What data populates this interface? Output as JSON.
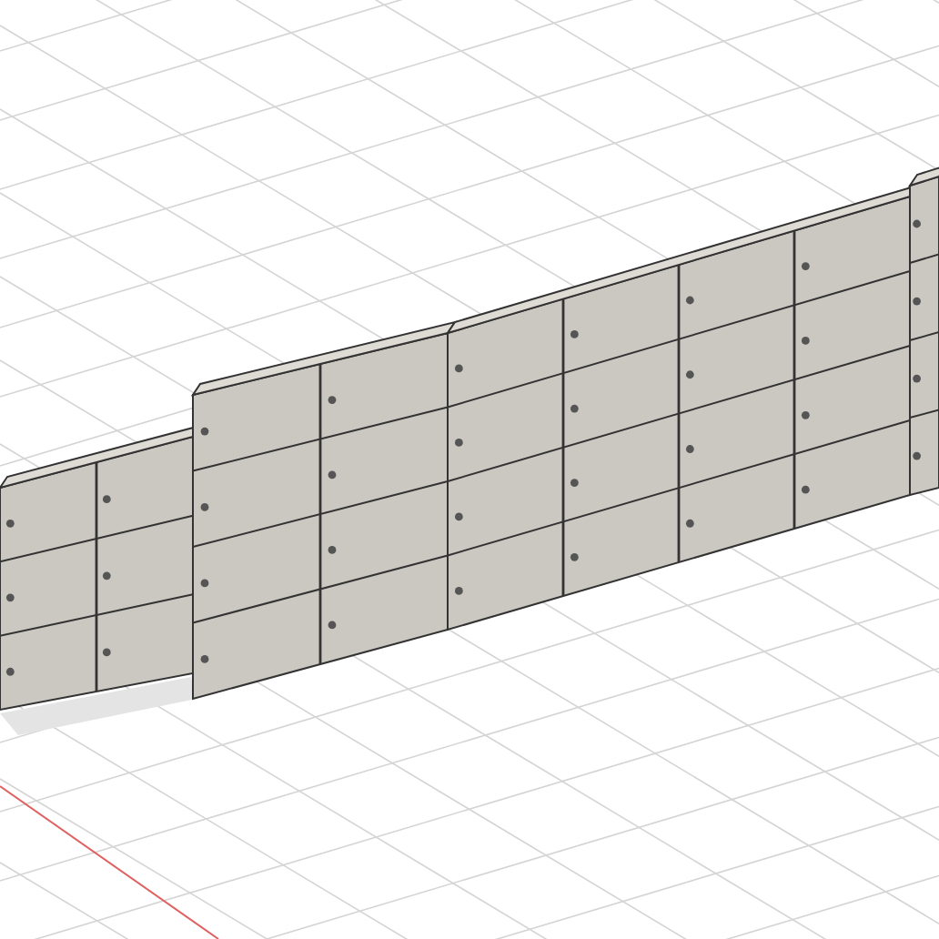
{
  "viewport": {
    "grid": true,
    "origin_axis": true
  }
}
